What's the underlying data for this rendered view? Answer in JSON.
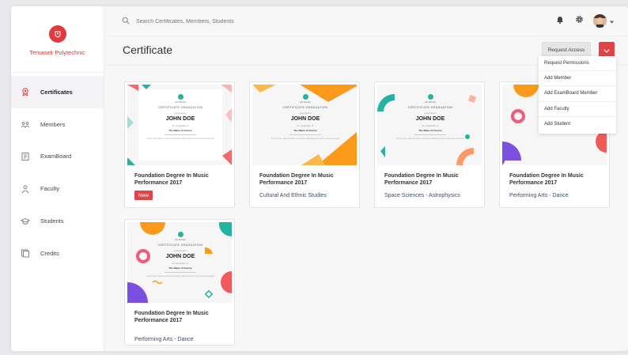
{
  "brand": {
    "name": "Temasek Polytechnic"
  },
  "nav": {
    "items": [
      {
        "label": "Certificates",
        "icon": "award-icon"
      },
      {
        "label": "Members",
        "icon": "members-icon"
      },
      {
        "label": "ExamBoard",
        "icon": "examboard-icon"
      },
      {
        "label": "Faculty",
        "icon": "faculty-icon"
      },
      {
        "label": "Students",
        "icon": "graduation-cap-icon"
      },
      {
        "label": "Credits",
        "icon": "credits-icon"
      }
    ]
  },
  "search": {
    "placeholder": "Search Certificates, Members, Students"
  },
  "page": {
    "title": "Certificate"
  },
  "actions": {
    "request_label": "Request Access",
    "menu": [
      "Request Permissions",
      "Add Member",
      "Add ExamBoard Member",
      "Add Faculty",
      "Add Student"
    ]
  },
  "certificate": {
    "school": "Alt School",
    "heading": "CERTIFICATE GRADUATION",
    "presented": "presented to",
    "name": "JOHN DOE",
    "for": "for completion of",
    "course": "The Name of Course",
    "footer": "Lorem ipsum dolor sit amet consectetur adipiscing elit sed do eiusmod tempor"
  },
  "cards": [
    {
      "title": "Foundation Degree In Music Performance 2017",
      "badge": "New",
      "subtitle": ""
    },
    {
      "title": "Foundation Degree In Music Performance 2017",
      "badge": "",
      "subtitle": "Cultural And Ethnic Studies"
    },
    {
      "title": "Foundation Degree In Music Performance 2017",
      "badge": "",
      "subtitle": "Space Sciences - Astrophysics"
    },
    {
      "title": "Foundation Degree In Music Performance 2017",
      "badge": "",
      "subtitle": "Performing Arts - Dance"
    },
    {
      "title": "Foundation Degree In Music Performance 2017",
      "badge": "",
      "subtitle": "Performing Arts - Dance"
    }
  ],
  "colors": {
    "accent": "#e04348",
    "teal": "#24b3a0",
    "orange": "#fb9a1a",
    "purple": "#7b4fe0"
  }
}
